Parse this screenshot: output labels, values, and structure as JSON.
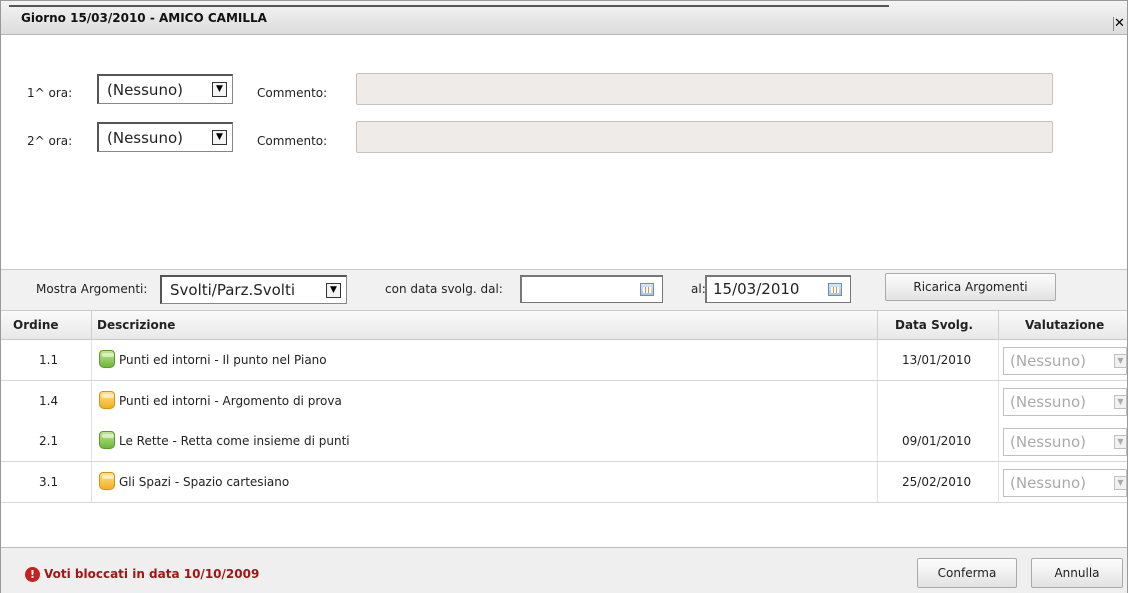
{
  "window": {
    "title": "Giorno 15/03/2010 - AMICO CAMILLA",
    "close_glyph": "✕"
  },
  "ore": [
    {
      "label": "1^ ora:",
      "selected": "(Nessuno)",
      "comment_label": "Commento:",
      "comment_value": ""
    },
    {
      "label": "2^ ora:",
      "selected": "(Nessuno)",
      "comment_label": "Commento:",
      "comment_value": ""
    }
  ],
  "filter": {
    "mostra_label": "Mostra Argomenti:",
    "mostra_selected": "Svolti/Parz.Svolti",
    "dal_label": "con data svolg. dal:",
    "dal_value": "",
    "al_label": "al:",
    "al_value": "15/03/2010",
    "ricarica_label": "Ricarica Argomenti"
  },
  "grid": {
    "headers": {
      "ordine": "Ordine",
      "descrizione": "Descrizione",
      "data": "Data Svolg.",
      "valutazione": "Valutazione"
    },
    "rows": [
      {
        "ordine": "1.1",
        "icon": "green-book-icon",
        "descrizione": "Punti ed intorni - Il punto nel Piano",
        "data": "13/01/2010",
        "valutazione": "(Nessuno)"
      },
      {
        "ordine": "1.4",
        "icon": "yellow-book-icon",
        "descrizione": "Punti ed intorni - Argomento di prova",
        "data": "",
        "valutazione": "(Nessuno)"
      },
      {
        "ordine": "2.1",
        "icon": "green-book-icon",
        "descrizione": "Le Rette - Retta come insieme di punti",
        "data": "09/01/2010",
        "valutazione": "(Nessuno)"
      },
      {
        "ordine": "3.1",
        "icon": "yellow-book-icon",
        "descrizione": "Gli Spazi - Spazio cartesiano",
        "data": "25/02/2010",
        "valutazione": "(Nessuno)"
      }
    ]
  },
  "footer": {
    "warning_icon": "!",
    "warning_text": "Voti bloccati in data 10/10/2009",
    "conferma_label": "Conferma",
    "annulla_label": "Annulla"
  },
  "colors": {
    "warning": "#a31515",
    "icon_green": "#6fb83a",
    "icon_yellow": "#f2b01e"
  }
}
